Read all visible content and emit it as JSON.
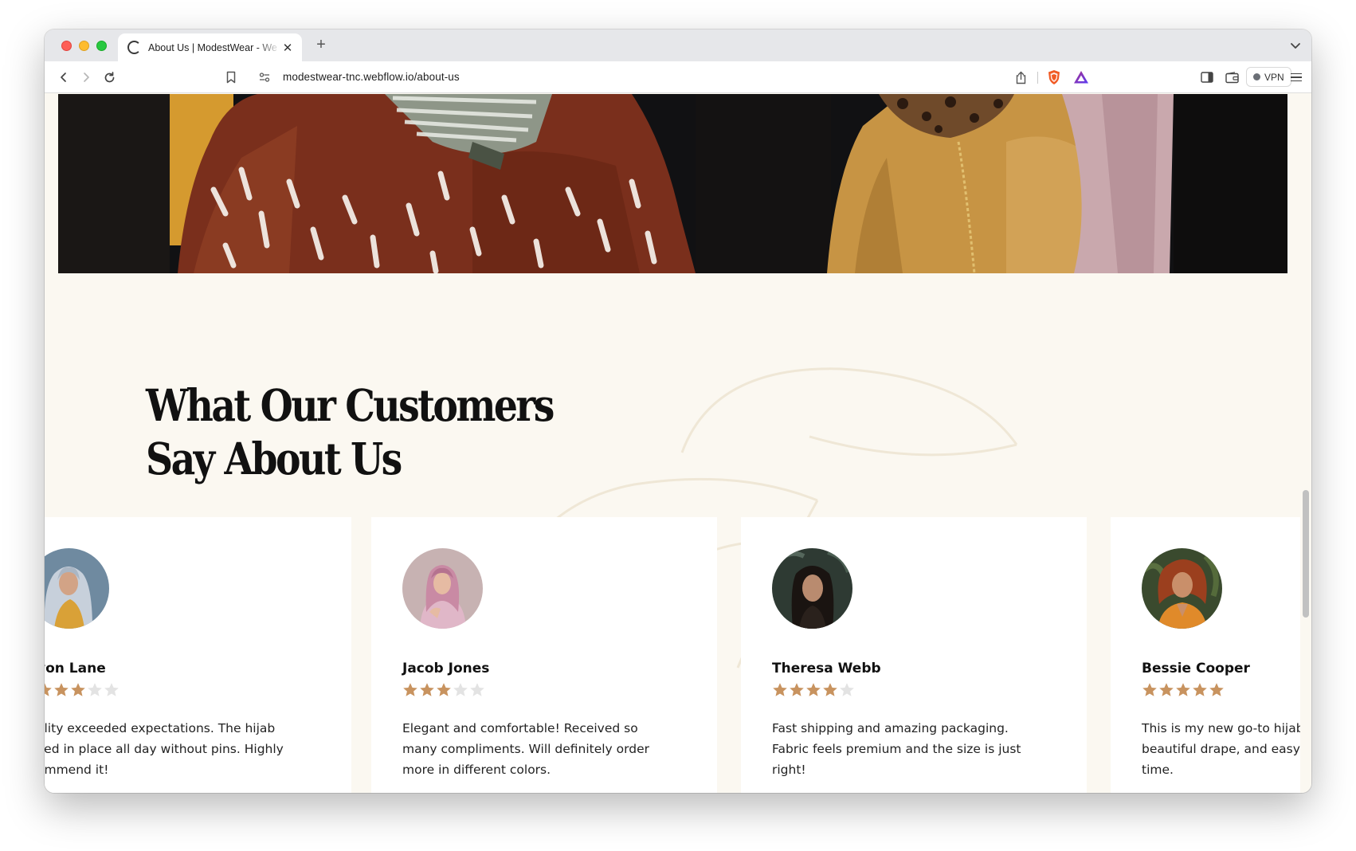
{
  "browser": {
    "tab_title": "About Us | ModestWear - We",
    "new_tab_label": "+",
    "url": "modestwear-tnc.webflow.io/about-us",
    "vpn_label": "VPN"
  },
  "testimonials": {
    "title_line1": "What Our Customers",
    "title_line2": "Say About Us",
    "cards": [
      {
        "name": "von Lane",
        "rating": 3,
        "max_rating": 5,
        "review": "ality exceeded expectations. The hijab\nyed in place all day without pins. Highly\nommend it!"
      },
      {
        "name": "Jacob Jones",
        "rating": 3,
        "max_rating": 5,
        "review": "Elegant and comfortable! Received so\nmany compliments. Will definitely order\nmore in different colors."
      },
      {
        "name": "Theresa Webb",
        "rating": 4,
        "max_rating": 5,
        "review": "Fast shipping and amazing packaging.\nFabric feels premium and the size is just\nright!"
      },
      {
        "name": "Bessie Cooper",
        "rating": 5,
        "max_rating": 5,
        "review": "This is my new go-to hijab.\nbeautiful drape, and easy t\ntime."
      }
    ]
  },
  "colors": {
    "page_background": "#fbf8f1",
    "star_filled": "#c8935f",
    "star_empty": "#e3e3e3",
    "title_text": "#111111"
  }
}
